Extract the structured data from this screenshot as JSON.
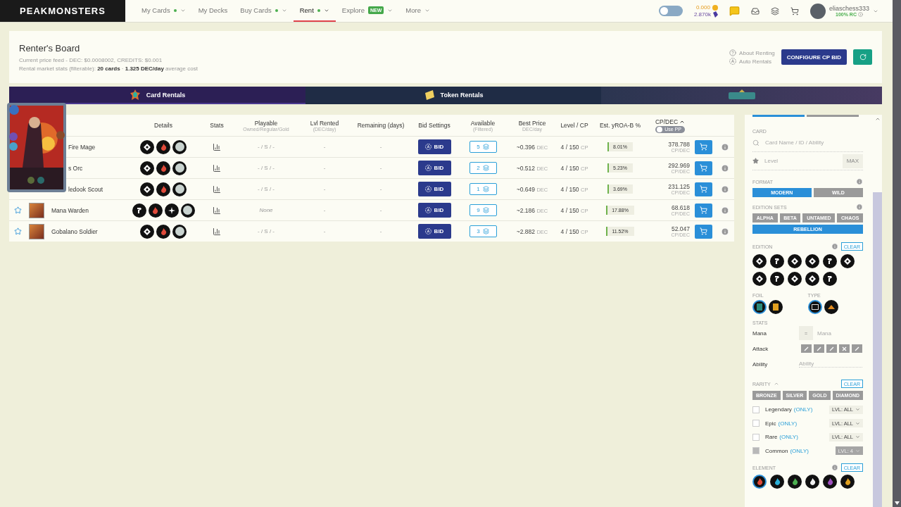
{
  "nav": {
    "logo": "PEAKMONSTERS",
    "items": [
      {
        "label": "My Cards",
        "dot": true,
        "dropdown": true,
        "selected": false
      },
      {
        "label": "My Decks",
        "dot": false,
        "dropdown": false,
        "selected": false
      },
      {
        "label": "Buy Cards",
        "dot": true,
        "dropdown": true,
        "selected": false
      },
      {
        "label": "Rent",
        "dot": true,
        "dropdown": true,
        "selected": true
      },
      {
        "label": "Explore",
        "dot": false,
        "badge": "NEW",
        "dropdown": true,
        "selected": false
      },
      {
        "label": "More",
        "dot": false,
        "dropdown": true,
        "selected": false
      }
    ],
    "theme_toggle": {
      "on": false
    },
    "balances": [
      {
        "value": "0.000",
        "kind": "coin"
      },
      {
        "value": "2.870k",
        "kind": "gem"
      }
    ],
    "user": {
      "name": "eliaschess333",
      "rc": "100% RC"
    }
  },
  "header": {
    "title": "Renter's Board",
    "price_feed": "Current price feed - DEC: $0.0008002, CREDITS: $0.001",
    "stats": "Rental market stats (filterable): **20 cards** · **1.325 DEC/day** average cost",
    "links": [
      {
        "label": "About Renting",
        "kind": "help"
      },
      {
        "label": "Auto Rentals",
        "kind": "auto"
      }
    ],
    "configure_button": "CONFIGURE CP BID"
  },
  "banner": [
    {
      "label": "Card Rentals",
      "kind": "cards",
      "selected": true
    },
    {
      "label": "Token Rentals",
      "kind": "tokens",
      "selected": false
    },
    {
      "kind": "logo",
      "selected": false
    }
  ],
  "table": {
    "columns": [
      {
        "label": "Details"
      },
      {
        "label": "Stats"
      },
      {
        "label": "Playable",
        "sub": "Owned/Regular/Gold"
      },
      {
        "label": "Lvl Rented",
        "sub": "(DEC/day)"
      },
      {
        "label": "Remaining (days)"
      },
      {
        "label": "Bid Settings"
      },
      {
        "label": "Available",
        "sub": "(Filtered)"
      },
      {
        "label": "Best Price",
        "sub": "DEC/day"
      },
      {
        "label": "Level / CP"
      },
      {
        "label": "Est. yROA-B %"
      },
      {
        "label": "CP/DEC",
        "sort_ascending": true
      }
    ],
    "use_pp": {
      "label": "Use PP",
      "on": false
    },
    "rows": [
      {
        "name": "Fire Mage",
        "covered": true,
        "details": [
          {
            "kind": "edition"
          },
          {
            "kind": "fire"
          },
          {
            "kind": "rarity"
          }
        ],
        "playable": {
          "text": "- / S / -",
          "kind": "values"
        },
        "lvl_rented": "-",
        "remaining": "-",
        "bid": "BID",
        "available": "5",
        "best_price": "~0.396",
        "price_unit": "DEC",
        "level_cp": "4 / 150",
        "cp_unit": "CP",
        "yroa": "8.01%",
        "cp_dec": "378.788",
        "cp_dec_unit": "CP/DEC"
      },
      {
        "name": "s Orc",
        "covered": true,
        "details": [
          {
            "kind": "edition"
          },
          {
            "kind": "fire"
          },
          {
            "kind": "rarity"
          }
        ],
        "playable": {
          "text": "- / S / -",
          "kind": "values"
        },
        "lvl_rented": "-",
        "remaining": "-",
        "bid": "BID",
        "available": "2",
        "best_price": "~0.512",
        "price_unit": "DEC",
        "level_cp": "4 / 150",
        "cp_unit": "CP",
        "yroa": "5.23%",
        "cp_dec": "292.969",
        "cp_dec_unit": "CP/DEC"
      },
      {
        "name": "ledook Scout",
        "covered": true,
        "details": [
          {
            "kind": "edition"
          },
          {
            "kind": "fire"
          },
          {
            "kind": "rarity"
          }
        ],
        "playable": {
          "text": "- / S / -",
          "kind": "values"
        },
        "lvl_rented": "-",
        "remaining": "-",
        "bid": "BID",
        "available": "1",
        "best_price": "~0.649",
        "price_unit": "DEC",
        "level_cp": "4 / 150",
        "cp_unit": "CP",
        "yroa": "3.69%",
        "cp_dec": "231.125",
        "cp_dec_unit": "CP/DEC"
      },
      {
        "name": "Mana Warden",
        "covered": false,
        "details": [
          {
            "kind": "untamed"
          },
          {
            "kind": "fire"
          },
          {
            "kind": "ability"
          },
          {
            "kind": "rarity"
          }
        ],
        "playable": {
          "text": "None",
          "kind": "none"
        },
        "lvl_rented": "-",
        "remaining": "-",
        "bid": "BID",
        "available": "9",
        "best_price": "~2.186",
        "price_unit": "DEC",
        "level_cp": "4 / 150",
        "cp_unit": "CP",
        "yroa": "17.88%",
        "cp_dec": "68.618",
        "cp_dec_unit": "CP/DEC"
      },
      {
        "name": "Gobalano Soldier",
        "covered": false,
        "details": [
          {
            "kind": "edition"
          },
          {
            "kind": "fire"
          },
          {
            "kind": "rarity"
          }
        ],
        "playable": {
          "text": "- / S / -",
          "kind": "values"
        },
        "lvl_rented": "-",
        "remaining": "-",
        "bid": "BID",
        "available": "3",
        "best_price": "~2.882",
        "price_unit": "DEC",
        "level_cp": "4 / 150",
        "cp_unit": "CP",
        "yroa": "11.52%",
        "cp_dec": "52.047",
        "cp_dec_unit": "CP/DEC"
      }
    ]
  },
  "filters": {
    "tabs": [
      {
        "selected": true
      },
      {
        "selected": false
      }
    ],
    "card": {
      "label": "CARD",
      "search_placeholder": "Card Name / ID / Ability",
      "level_placeholder": "Level",
      "max_button": "MAX"
    },
    "format": {
      "label": "FORMAT",
      "options": [
        {
          "label": "MODERN",
          "selected": true
        },
        {
          "label": "WILD",
          "selected": false
        }
      ]
    },
    "edition_sets": {
      "label": "EDITION SETS",
      "options": [
        {
          "label": "ALPHA",
          "selected": false
        },
        {
          "label": "BETA",
          "selected": false
        },
        {
          "label": "UNTAMED",
          "selected": false
        },
        {
          "label": "CHAOS",
          "selected": false
        },
        {
          "label": "REBELLION",
          "selected": true
        }
      ]
    },
    "edition": {
      "label": "EDITION",
      "clear": "CLEAR"
    },
    "foil": {
      "label": "FOIL",
      "options": [
        {
          "kind": "regular",
          "selected": true
        },
        {
          "kind": "gold",
          "selected": false
        }
      ]
    },
    "type": {
      "label": "TYPE",
      "options": [
        {
          "kind": "monster",
          "selected": true
        },
        {
          "kind": "summoner",
          "selected": false
        }
      ]
    },
    "stats": {
      "label": "STATS",
      "mana": {
        "label": "Mana",
        "operator": "=",
        "placeholder": "Mana"
      },
      "attack": {
        "label": "Attack"
      },
      "ability": {
        "label": "Ability",
        "placeholder": "Ability"
      }
    },
    "rarity": {
      "label": "RARITY",
      "expanded": true,
      "clear": "CLEAR",
      "tiers": [
        "BRONZE",
        "SILVER",
        "GOLD",
        "DIAMOND"
      ],
      "items": [
        {
          "name": "Legendary",
          "only": "(ONLY)",
          "checked": false,
          "lvl_filter": "LVL: ALL"
        },
        {
          "name": "Epic",
          "only": "(ONLY)",
          "checked": false,
          "lvl_filter": "LVL: ALL"
        },
        {
          "name": "Rare",
          "only": "(ONLY)",
          "checked": false,
          "lvl_filter": "LVL: ALL"
        },
        {
          "name": "Common",
          "only": "(ONLY)",
          "checked": true,
          "lvl_filter": "LVL: 4"
        }
      ]
    },
    "element": {
      "label": "ELEMENT",
      "clear": "CLEAR",
      "options": [
        {
          "kind": "fire",
          "selected": true
        },
        {
          "kind": "water",
          "selected": false
        },
        {
          "kind": "earth",
          "selected": false
        },
        {
          "kind": "life",
          "selected": false
        },
        {
          "kind": "death",
          "selected": false
        },
        {
          "kind": "dragon",
          "selected": false
        }
      ]
    }
  }
}
